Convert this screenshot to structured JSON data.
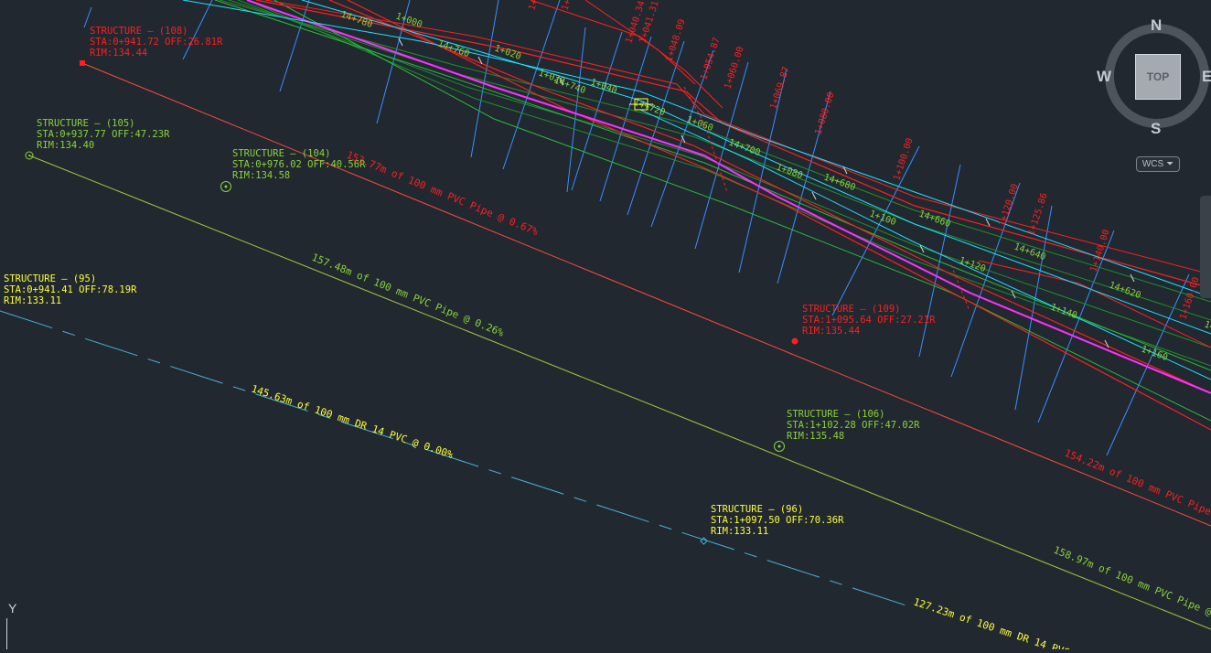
{
  "colors": {
    "background": "#212830",
    "red": "#ff1f1f",
    "green": "#8bd33a",
    "yellow": "#ffff3a",
    "cyan": "#20e0ff",
    "blue": "#3a8fff",
    "magenta": "#ff30ff",
    "darkgreen": "#1f8f2a"
  },
  "viewcube": {
    "top_label": "TOP",
    "north": "N",
    "south": "S",
    "east": "E",
    "west": "W",
    "wcs_label": "WCS",
    "wcs_arrow": "⏷"
  },
  "ucs": {
    "y_label": "Y"
  },
  "structures": [
    {
      "id": "108",
      "name": "STRUCTURE – (108)",
      "sta": "STA:0+941.72  OFF:26.81R",
      "rim": "RIM:134.44",
      "color": "red"
    },
    {
      "id": "105",
      "name": "STRUCTURE – (105)",
      "sta": "STA:0+937.77  OFF:47.23R",
      "rim": "RIM:134.40",
      "color": "green"
    },
    {
      "id": "104",
      "name": "STRUCTURE – (104)",
      "sta": "STA:0+976.02  OFF:40.56R",
      "rim": "RIM:134.58",
      "color": "green"
    },
    {
      "id": "95",
      "name": "STRUCTURE – (95)",
      "sta": "STA:0+941.41  OFF:78.19R",
      "rim": "RIM:133.11",
      "color": "yellow"
    },
    {
      "id": "109",
      "name": "STRUCTURE – (109)",
      "sta": "STA:1+095.64  OFF:27.21R",
      "rim": "RIM:135.44",
      "color": "red"
    },
    {
      "id": "106",
      "name": "STRUCTURE – (106)",
      "sta": "STA:1+102.28  OFF:47.02R",
      "rim": "RIM:135.48",
      "color": "green"
    },
    {
      "id": "96",
      "name": "STRUCTURE – (96)",
      "sta": "STA:1+097.50  OFF:70.36R",
      "rim": "RIM:133.11",
      "color": "yellow"
    }
  ],
  "pipes": [
    {
      "label": "153.77m of 100 mm PVC Pipe @ 0.67%",
      "color": "red"
    },
    {
      "label": "157.48m of 100 mm PVC Pipe @ 0.26%",
      "color": "green"
    },
    {
      "label": "145.63m of 100 mm DR 14 PVC @ 0.00%",
      "color": "yellow"
    },
    {
      "label": "154.22m of 100 mm PVC Pipe",
      "color": "red"
    },
    {
      "label": "158.97m of 100 mm PVC Pipe @",
      "color": "green"
    },
    {
      "label": "127.23m of 100 mm DR 14 PVC",
      "color": "yellow"
    }
  ],
  "stations_red": [
    "1+0",
    "1+0",
    "1+040.34",
    "1+041.31",
    "1+048.09",
    "1+054.87",
    "1+060.00",
    "1+069.87",
    "1+080.00",
    "1+100.00",
    "1+120.00",
    "1+125.86",
    "1+140.00",
    "1+160.00"
  ],
  "stations_green": [
    "1+000",
    "14+760",
    "14+780",
    "1+020",
    "1+040",
    "14+700",
    "1+060",
    "1+080",
    "14+680",
    "1+100",
    "14+660",
    "1+120",
    "14+640",
    "1+140",
    "14+620",
    "1+160",
    "14+720",
    "1+020",
    "14+740",
    "14"
  ]
}
